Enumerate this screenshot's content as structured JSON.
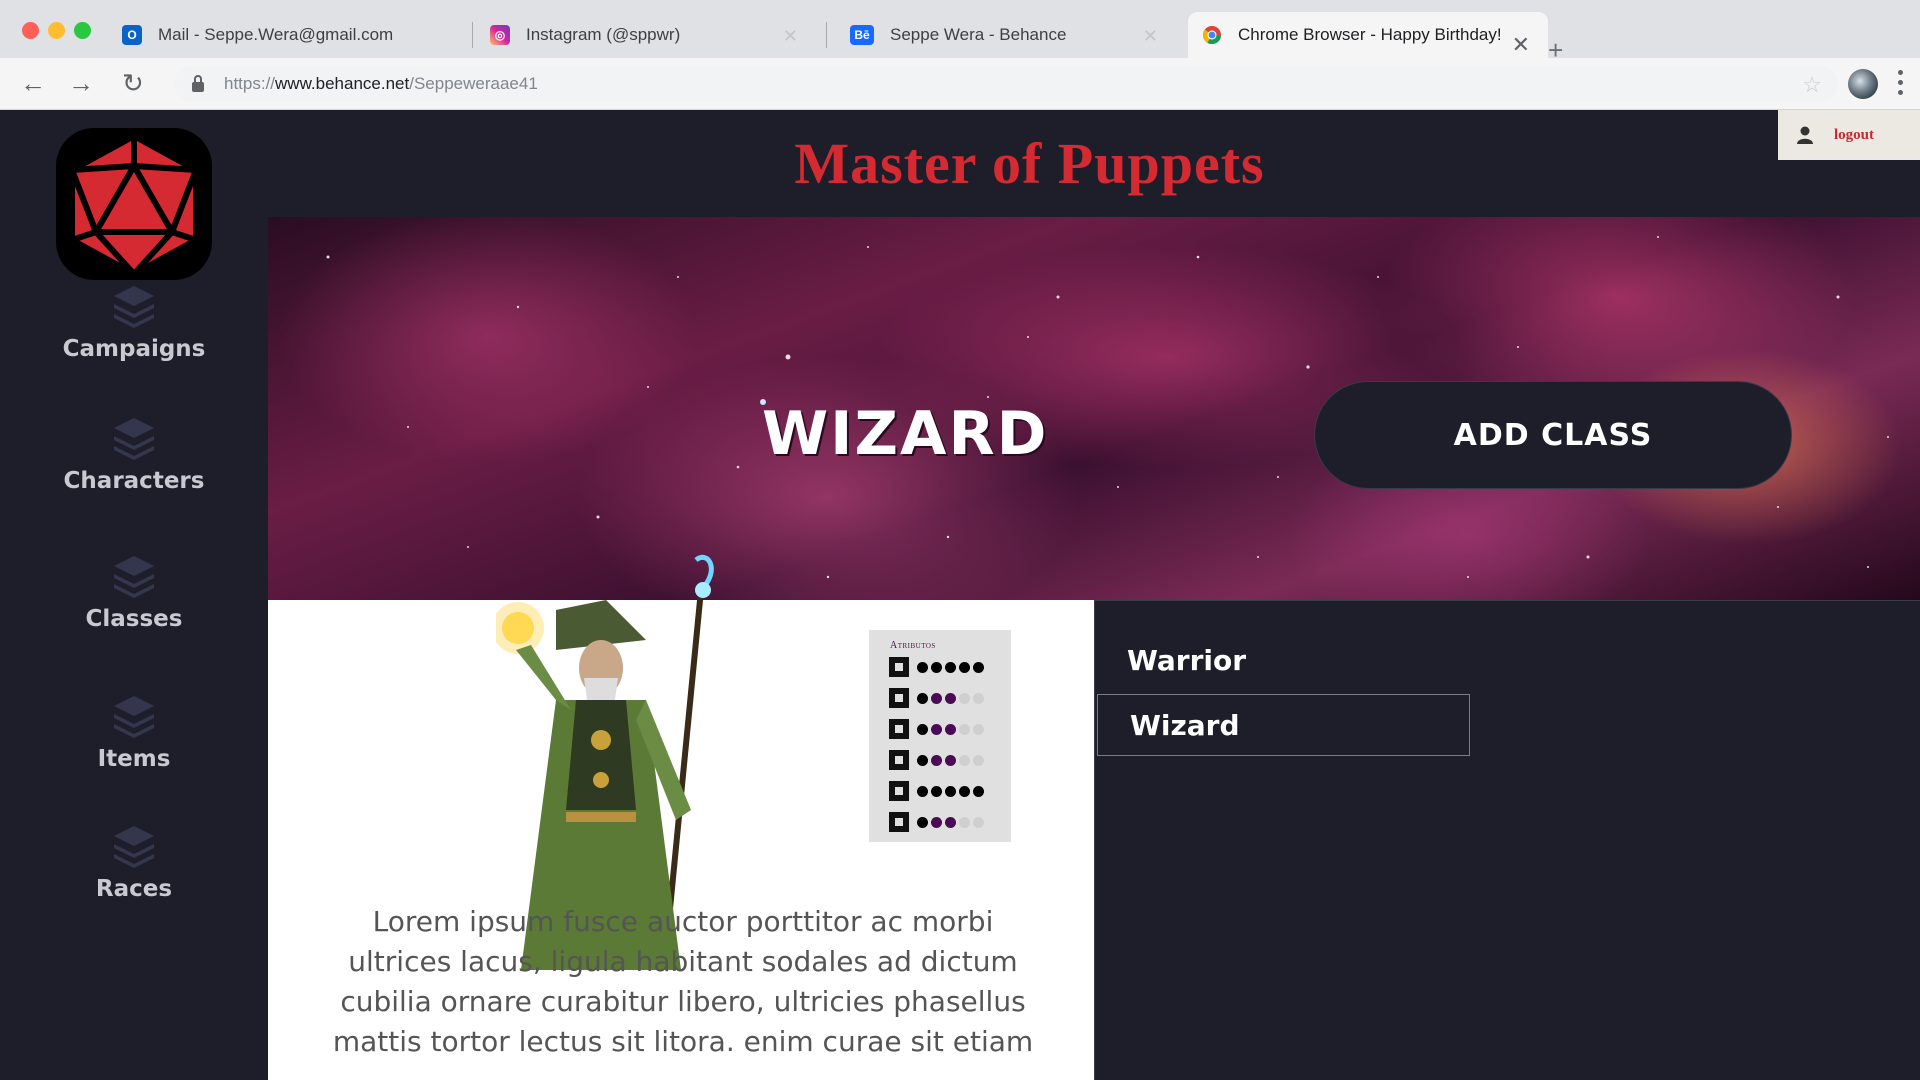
{
  "browser": {
    "tabs": [
      {
        "title": "Mail - Seppe.Wera@gmail.com",
        "favicon": "outlook-icon",
        "color": "#0a64c8"
      },
      {
        "title": "Instagram (@sppwr)",
        "favicon": "instagram-icon",
        "color": "#d6249f"
      },
      {
        "title": "Seppe Wera - Behance",
        "favicon": "behance-icon",
        "color": "#1769ff"
      },
      {
        "title": "Chrome Browser - Happy Birthday!",
        "favicon": "chrome-icon",
        "color": "#4285f4"
      }
    ],
    "url_scheme": "https://",
    "url_domain": "www.behance.net",
    "url_path": "/Seppeweraae41"
  },
  "sidebar": {
    "items": [
      {
        "label": "Campaigns",
        "icon": "layers-icon"
      },
      {
        "label": "Characters",
        "icon": "layers-icon"
      },
      {
        "label": "Classes",
        "icon": "layers-icon"
      },
      {
        "label": "Items",
        "icon": "layers-icon"
      },
      {
        "label": "Races",
        "icon": "layers-icon"
      }
    ]
  },
  "header": {
    "title": "Master of Puppets",
    "logout_label": "logout"
  },
  "banner": {
    "class_title": "WIZARD",
    "add_button_label": "ADD CLASS"
  },
  "attributes": {
    "title": "Atributos",
    "rows": [
      {
        "icon": "strength-icon",
        "level": 5
      },
      {
        "icon": "agility-icon",
        "level": 3
      },
      {
        "icon": "perception-icon",
        "level": 3
      },
      {
        "icon": "spirit-icon",
        "level": 3
      },
      {
        "icon": "endurance-icon",
        "level": 5
      },
      {
        "icon": "balance-icon",
        "level": 3
      }
    ]
  },
  "description": "Lorem ipsum fusce auctor porttitor ac morbi ultrices lacus, ligula habitant sodales ad dictum cubilia ornare curabitur libero, ultricies phasellus mattis tortor lectus sit litora. enim curae sit etiam",
  "class_list": {
    "items": [
      {
        "label": "Warrior",
        "selected": false
      },
      {
        "label": "Wizard",
        "selected": true
      }
    ]
  },
  "colors": {
    "background": "#1e1e2b",
    "title_red": "#d62a33",
    "attr_purple": "#4b0a55",
    "white": "#ffffff"
  }
}
